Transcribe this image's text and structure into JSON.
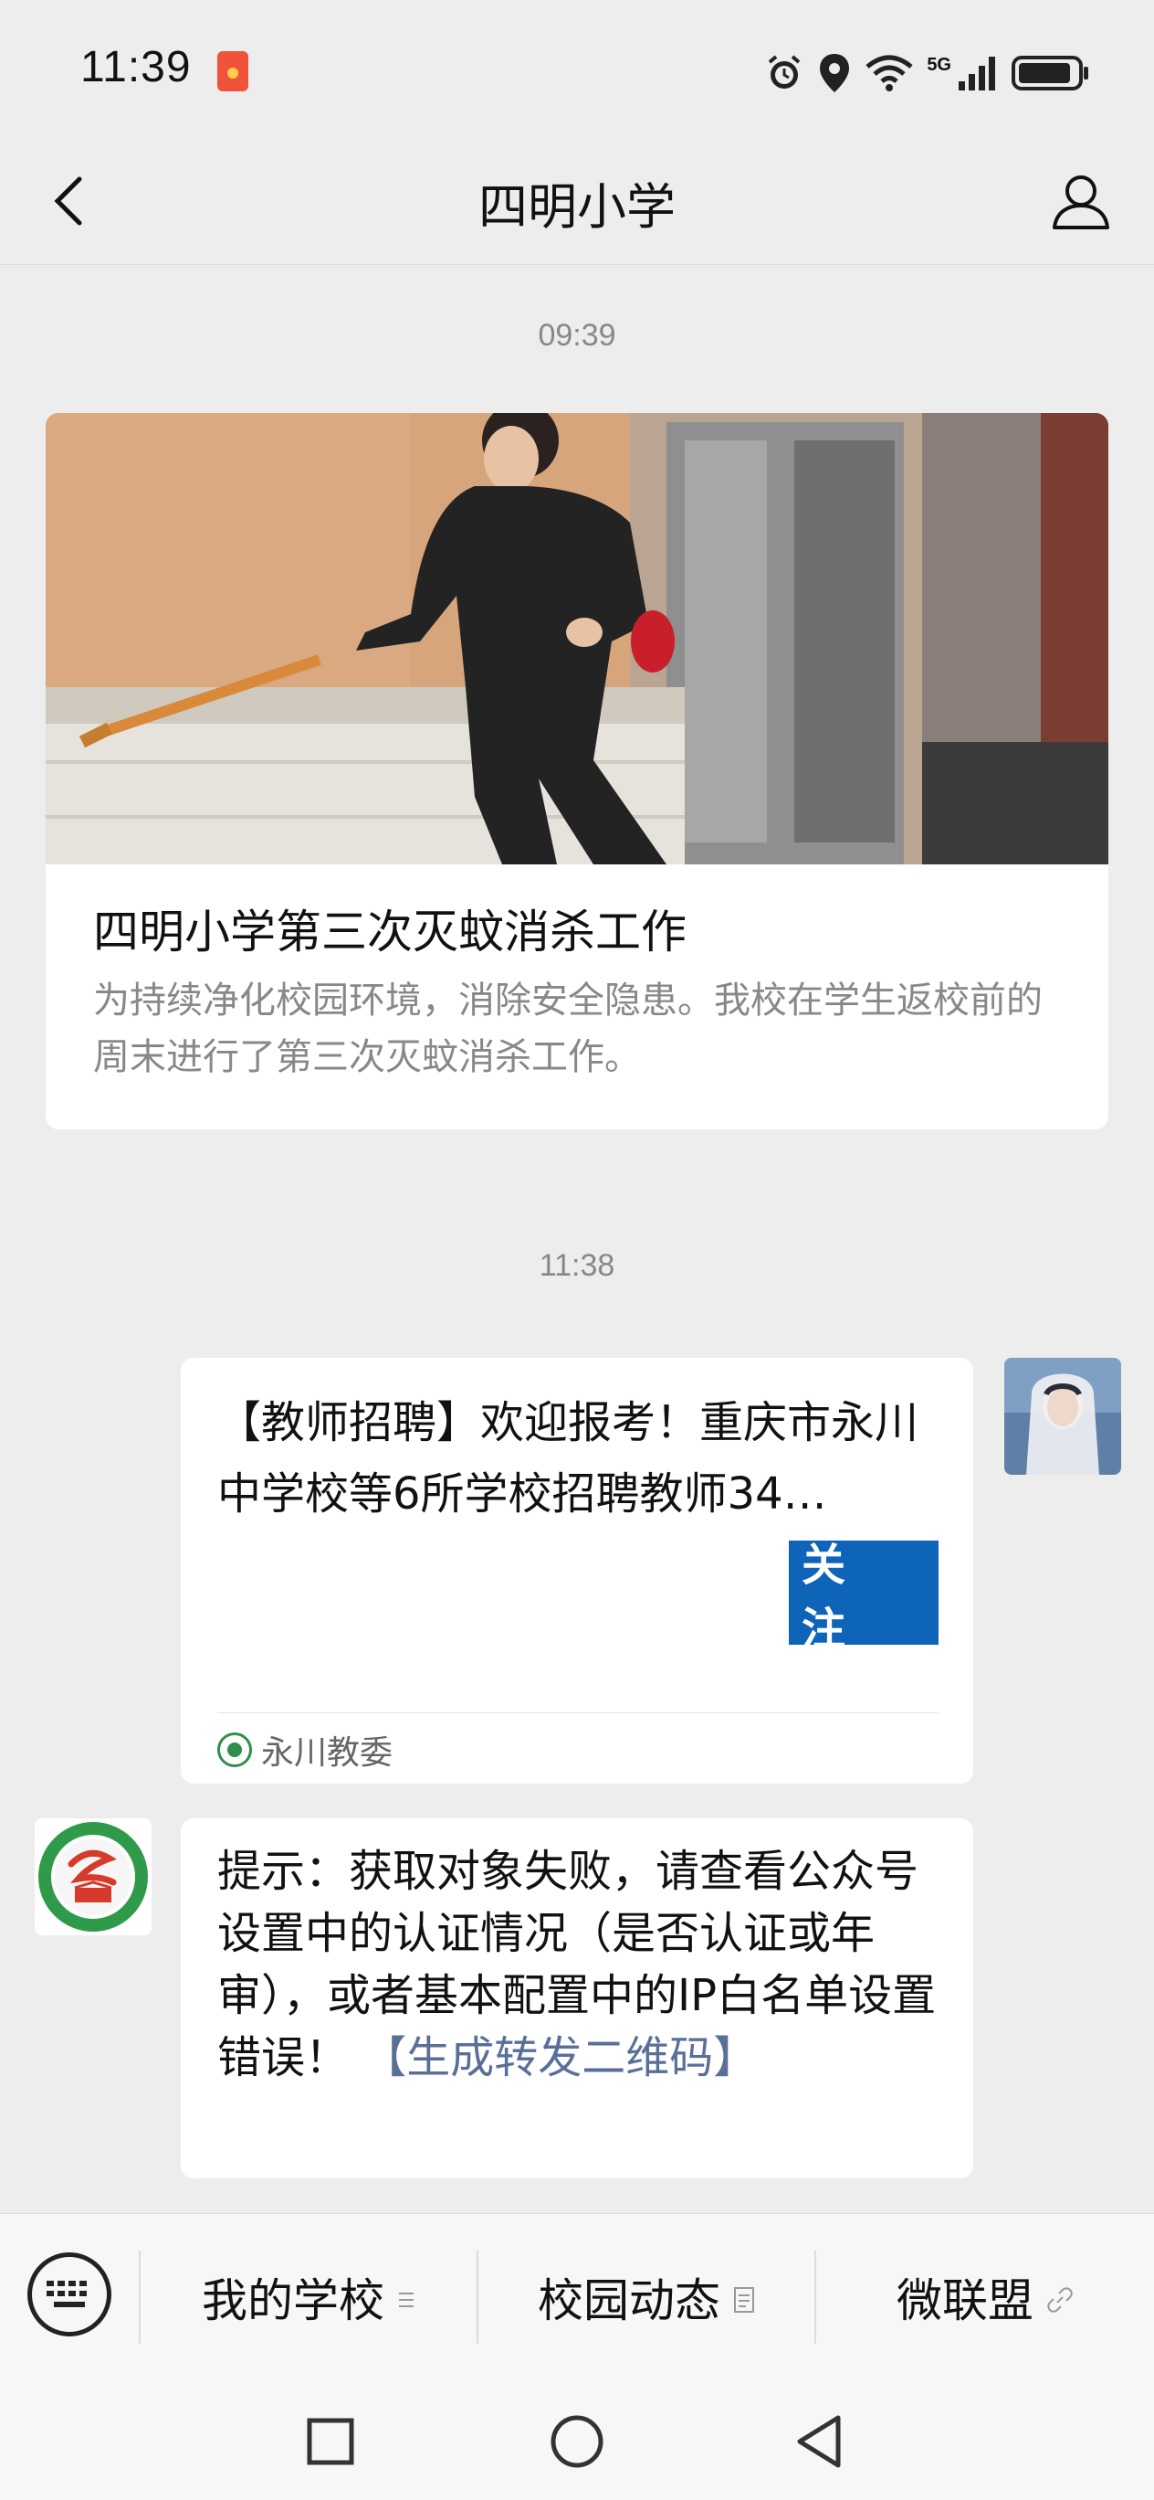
{
  "status_bar": {
    "time": "11:39",
    "network_label": "5G"
  },
  "nav": {
    "title": "四明小学"
  },
  "messages": {
    "time_1": "09:39",
    "article": {
      "title": "四明小学第三次灭蚊消杀工作",
      "description": "为持续净化校园环境，消除安全隐患。我校在学生返校前的周末进行了第三次灭蚊消杀工作。"
    },
    "time_2": "11:38",
    "recruit_card": {
      "text": "【教师招聘】欢迎报考！重庆市永川中学校等6所学校招聘教师34…",
      "follow_label": "关 注",
      "source_name": "永川教委"
    },
    "hint": {
      "text": "提示：获取对象失败，请查看公众号设置中的认证情况（是否认证或年审），或者基本配置中的IP白名单设置错误！",
      "link_text": "【生成转发二维码】"
    }
  },
  "bottom_menu": {
    "items": [
      {
        "label": "我的学校",
        "icon": "list-lines-icon"
      },
      {
        "label": "校园动态",
        "icon": "document-icon"
      },
      {
        "label": "微联盟",
        "icon": "link-icon"
      }
    ]
  },
  "colors": {
    "background": "#ededed",
    "follow_button": "#0e64b8",
    "link": "#5a6f98"
  }
}
